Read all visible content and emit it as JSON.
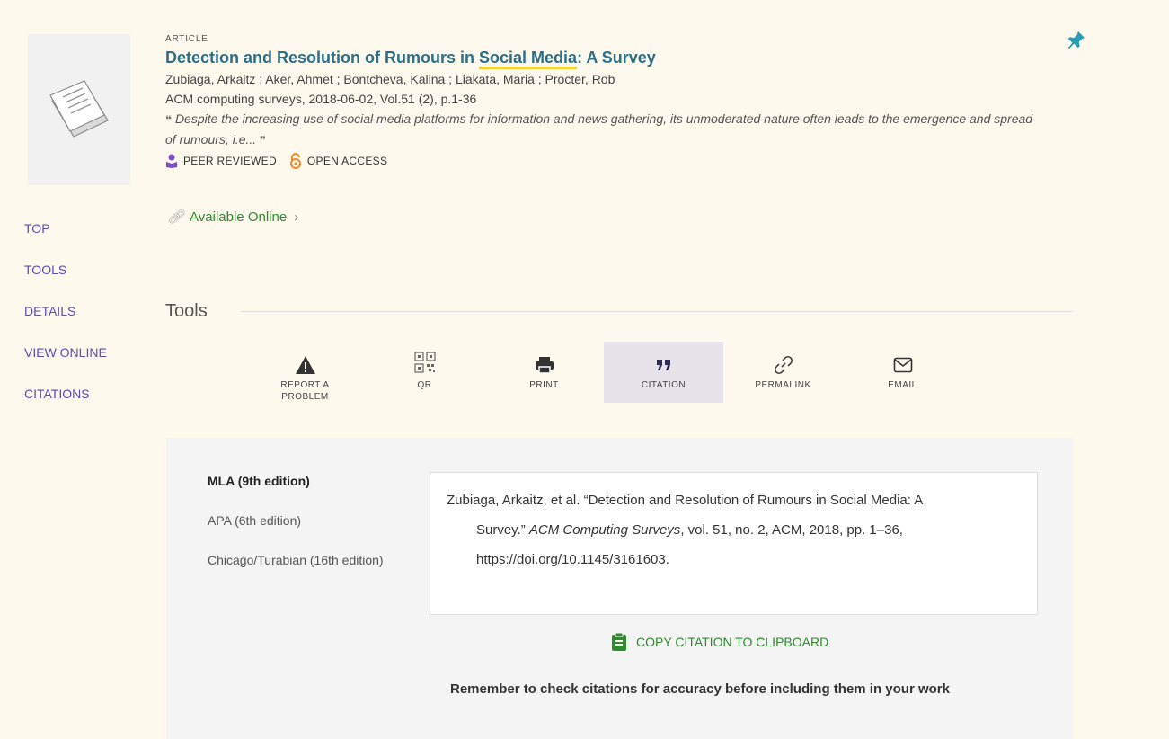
{
  "record": {
    "type": "ARTICLE",
    "title_pre": "Detection and Resolution of Rumours in ",
    "title_hl": "Social Media",
    "title_post": ": A Survey",
    "authors": "Zubiaga, Arkaitz ; Aker, Ahmet ; Bontcheva, Kalina ; Liakata, Maria ; Procter, Rob",
    "source": "ACM computing surveys, 2018-06-02, Vol.51 (2), p.1-36",
    "snippet": "Despite the increasing use of social media platforms for information and news gathering, its unmoderated nature often leads to the emergence and spread of rumours, i.e...",
    "badges": {
      "peer_reviewed": "PEER REVIEWED",
      "open_access": "OPEN ACCESS"
    },
    "availability": "Available Online"
  },
  "sidenav": [
    "TOP",
    "TOOLS",
    "DETAILS",
    "VIEW ONLINE",
    "CITATIONS"
  ],
  "tools": {
    "heading": "Tools",
    "items": [
      {
        "label": "REPORT A PROBLEM",
        "icon": "warning-icon"
      },
      {
        "label": "QR",
        "icon": "qr-code-icon"
      },
      {
        "label": "PRINT",
        "icon": "printer-icon"
      },
      {
        "label": "CITATION",
        "icon": "quote-icon",
        "active": true
      },
      {
        "label": "PERMALINK",
        "icon": "link-icon"
      },
      {
        "label": "EMAIL",
        "icon": "envelope-icon"
      }
    ]
  },
  "citation": {
    "styles": [
      "MLA (9th edition)",
      "APA (6th edition)",
      "Chicago/Turabian (16th edition)"
    ],
    "selected_style": "MLA (9th edition)",
    "line1": "Zubiaga, Arkaitz, et al. “Detection and Resolution of Rumours in Social Media: A",
    "line2_pre": "Survey.” ",
    "line2_italic": "ACM Computing Surveys",
    "line2_post": ", vol. 51, no. 2, ACM, 2018, pp. 1–36,",
    "line3": "https://doi.org/10.1145/3161603.",
    "copy_label": "COPY CITATION TO CLIPBOARD",
    "reminder": "Remember to check citations for accuracy before including them in your work"
  },
  "colors": {
    "background": "#fdf9ec",
    "title": "#2d6f87",
    "nav": "#5b4db3",
    "green": "#2e8b2e",
    "open_access": "#f08a24",
    "peer_reviewed": "#7b4cc2",
    "highlight": "#f6cf3b"
  }
}
